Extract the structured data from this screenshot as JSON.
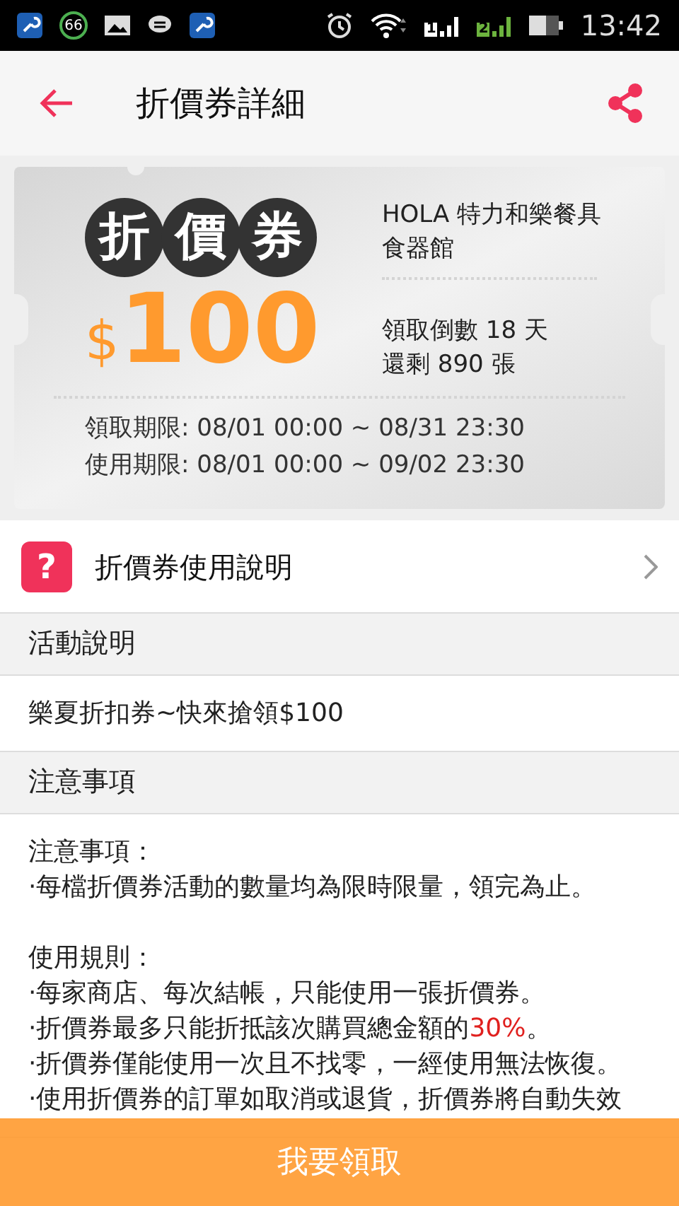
{
  "status_bar": {
    "badge": "66",
    "sim_1": "1",
    "sim_2": "2",
    "time": "13:42"
  },
  "app_bar": {
    "title": "折價券詳細"
  },
  "coupon": {
    "stamp": [
      "折",
      "價",
      "券"
    ],
    "currency": "$",
    "amount": "100",
    "store": "HOLA 特力和樂餐具食器館",
    "countdown": "領取倒數 18 天",
    "remaining": "還剩 890 張",
    "claim_period": "領取期限: 08/01 00:00 ~ 08/31 23:30",
    "use_period": "使用期限: 08/01 00:00 ~ 09/02 23:30"
  },
  "usage_link": {
    "icon_text": "?",
    "label": "折價券使用說明"
  },
  "sections": [
    {
      "title": "活動說明",
      "paragraphs": [
        {
          "lines": [
            [
              {
                "text": "樂夏折扣券~快來搶領$100",
                "emphasis": false
              }
            ]
          ]
        }
      ]
    },
    {
      "title": "注意事項",
      "paragraphs": [
        {
          "lines": [
            [
              {
                "text": "注意事項：",
                "emphasis": false
              }
            ],
            [
              {
                "text": "·每檔折價券活動的數量均為限時限量，領完為止。",
                "emphasis": false
              }
            ]
          ]
        },
        {
          "lines": [
            [
              {
                "text": "使用規則：",
                "emphasis": false
              }
            ],
            [
              {
                "text": "·每家商店、每次結帳，只能使用一張折價券。",
                "emphasis": false
              }
            ],
            [
              {
                "text": "·折價券最多只能折抵該次購買總金額的",
                "emphasis": false
              },
              {
                "text": "30%",
                "emphasis": true
              },
              {
                "text": "。",
                "emphasis": false
              }
            ],
            [
              {
                "text": "·折價券僅能使用一次且不找零，一經使用無法恢復。",
                "emphasis": false
              }
            ],
            [
              {
                "text": "·使用折價券的訂單如取消或退貨，折價券將自動失效",
                "emphasis": false
              }
            ]
          ]
        }
      ]
    }
  ],
  "claim_button": {
    "label": "我要領取"
  }
}
